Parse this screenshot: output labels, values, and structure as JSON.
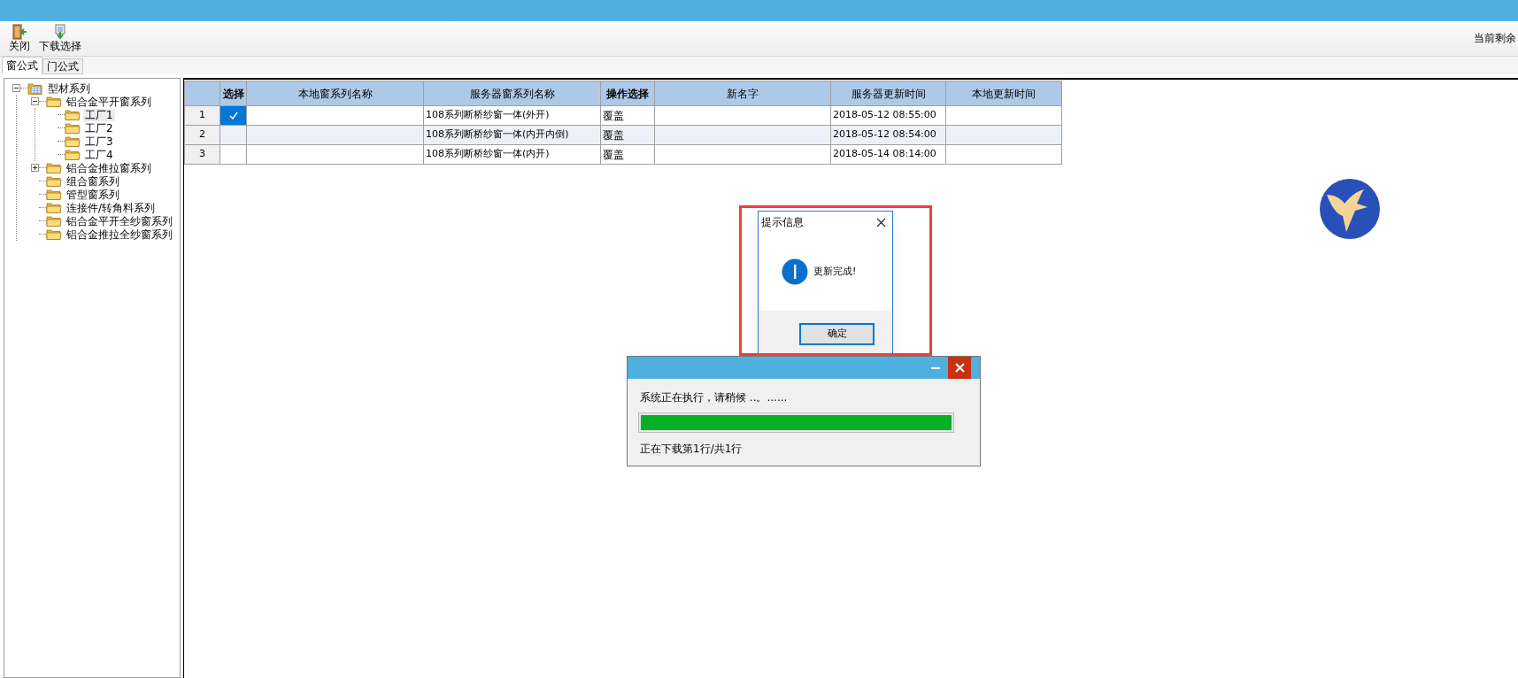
{
  "toolbar": {
    "buttons": [
      {
        "label": "关闭",
        "kind": "close"
      },
      {
        "label": "下载选择",
        "kind": "download"
      }
    ],
    "status_text": "当前剩余"
  },
  "tabs": [
    {
      "label": "窗公式",
      "selected": true
    },
    {
      "label": "门公式",
      "selected": false
    }
  ],
  "tree": {
    "label": "型材系列",
    "expanded": true,
    "selected": false,
    "children": [
      {
        "label": "铝合金平开窗系列",
        "expanded": true,
        "selected": false,
        "children": [
          {
            "label": "工厂1",
            "selected": true
          },
          {
            "label": "工厂2",
            "selected": false
          },
          {
            "label": "工厂3",
            "selected": false
          },
          {
            "label": "工厂4",
            "selected": false
          }
        ]
      },
      {
        "label": "铝合金推拉窗系列",
        "expanded": false,
        "selected": false
      },
      {
        "label": "组合窗系列",
        "selected": false
      },
      {
        "label": "管型窗系列",
        "selected": false
      },
      {
        "label": "连接件/转角料系列",
        "selected": false
      },
      {
        "label": "铝合金平开全纱窗系列",
        "selected": false
      },
      {
        "label": "铝合金推拉全纱窗系列",
        "selected": false
      }
    ]
  },
  "table": {
    "columns": [
      {
        "label": "选择",
        "bold": true
      },
      {
        "label": "本地窗系列名称",
        "bold": false
      },
      {
        "label": "服务器窗系列名称",
        "bold": false
      },
      {
        "label": "操作选择",
        "bold": true
      },
      {
        "label": "新名字",
        "bold": false
      },
      {
        "label": "服务器更新时间",
        "bold": false
      },
      {
        "label": "本地更新时间",
        "bold": false
      }
    ],
    "rows": [
      {
        "number": "1",
        "checked": true,
        "server_name": "108系列断桥纱窗一体(外开)",
        "action": "覆盖",
        "server_time": "2018-05-12 08:55:00"
      },
      {
        "number": "2",
        "checked": false,
        "server_name": "108系列断桥纱窗一体(内开内倒)",
        "action": "覆盖",
        "server_time": "2018-05-12 08:54:00"
      },
      {
        "number": "3",
        "checked": false,
        "server_name": "108系列断桥纱窗一体(内开)",
        "action": "覆盖",
        "server_time": "2018-05-14 08:14:00"
      }
    ]
  },
  "message_dialog": {
    "title": "提示信息",
    "message": "更新完成!",
    "button": "确定"
  },
  "progress_window": {
    "message": "系统正在执行，请稍候 ..。......",
    "level": 1,
    "status": "正在下载第1行/共1行"
  }
}
